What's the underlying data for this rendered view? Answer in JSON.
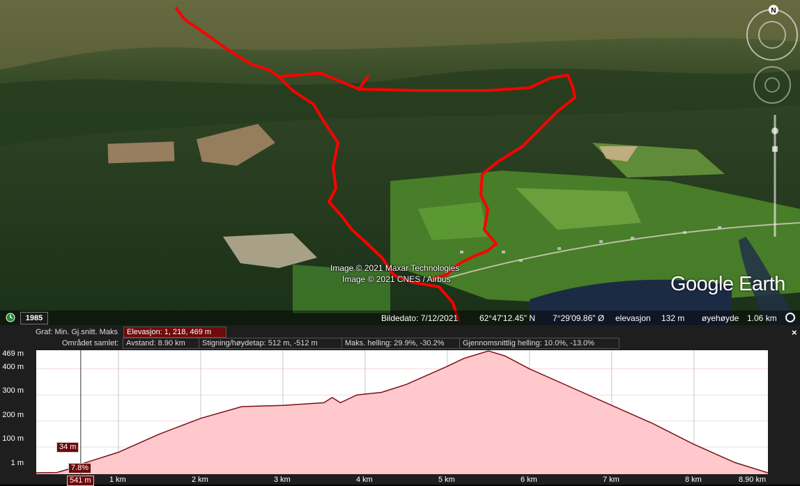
{
  "map": {
    "attribution": [
      "Image © 2021 Maxar Technologies",
      "Image © 2021 CNES / Airbus"
    ],
    "logo": "Google Earth",
    "compass_label": "N",
    "status": {
      "year": "1985",
      "date": "Bildedato: 7/12/2021",
      "lat": "62°47'12.45\" N",
      "lon": "7°29'09.86\" Ø",
      "elev_label": "elevasjon",
      "elev_value": "132 m",
      "eye_label": "øyehøyde",
      "eye_value": "1.06 km"
    },
    "colors": {
      "track": "#ff0000",
      "forest": "#1d3a1a",
      "field": "#4f8a2c",
      "water": "#1c2b44"
    }
  },
  "panel": {
    "close_label": "×",
    "graph_label": "Graf: Min. Gj.snitt. Maks",
    "elevation_stat": "Elevasjon: 1, 218, 469 m",
    "area_label": "Området samlet:",
    "distance": "Avstand: 8.90 km",
    "climb": "Stigning/høydetap: 512 m, -512 m",
    "max_slope": "Maks. helling: 29.9%, -30.2%",
    "avg_slope": "Gjennomsnittlig helling: 10.0%, -13.0%",
    "cursor": {
      "elevation": "34 m",
      "slope": "7.8%",
      "distance": "541 m"
    }
  },
  "chart_data": {
    "type": "area",
    "x_unit": "km",
    "y_unit": "m",
    "xlim": [
      0,
      8.9
    ],
    "ylim": [
      1,
      469
    ],
    "x_ticks": [
      "1 km",
      "2 km",
      "3 km",
      "4 km",
      "5 km",
      "6 km",
      "7 km",
      "8 km",
      "8.90 km"
    ],
    "y_ticks": [
      "469 m",
      "400 m",
      "300 m",
      "200 m",
      "100 m",
      "1 m"
    ],
    "fill_color": "#ffc8cc",
    "line_color": "#7a0f14",
    "cursor_x": 0.541,
    "x": [
      0,
      0.25,
      0.45,
      0.541,
      1.0,
      1.5,
      2.0,
      2.5,
      3.0,
      3.5,
      3.6,
      3.7,
      3.9,
      4.2,
      4.5,
      5.0,
      5.2,
      5.5,
      5.7,
      6.0,
      6.5,
      7.0,
      7.5,
      8.0,
      8.5,
      8.9
    ],
    "y": [
      1,
      2,
      20,
      34,
      80,
      150,
      210,
      255,
      260,
      270,
      290,
      270,
      300,
      310,
      340,
      410,
      440,
      469,
      450,
      400,
      330,
      260,
      190,
      110,
      40,
      1
    ]
  }
}
